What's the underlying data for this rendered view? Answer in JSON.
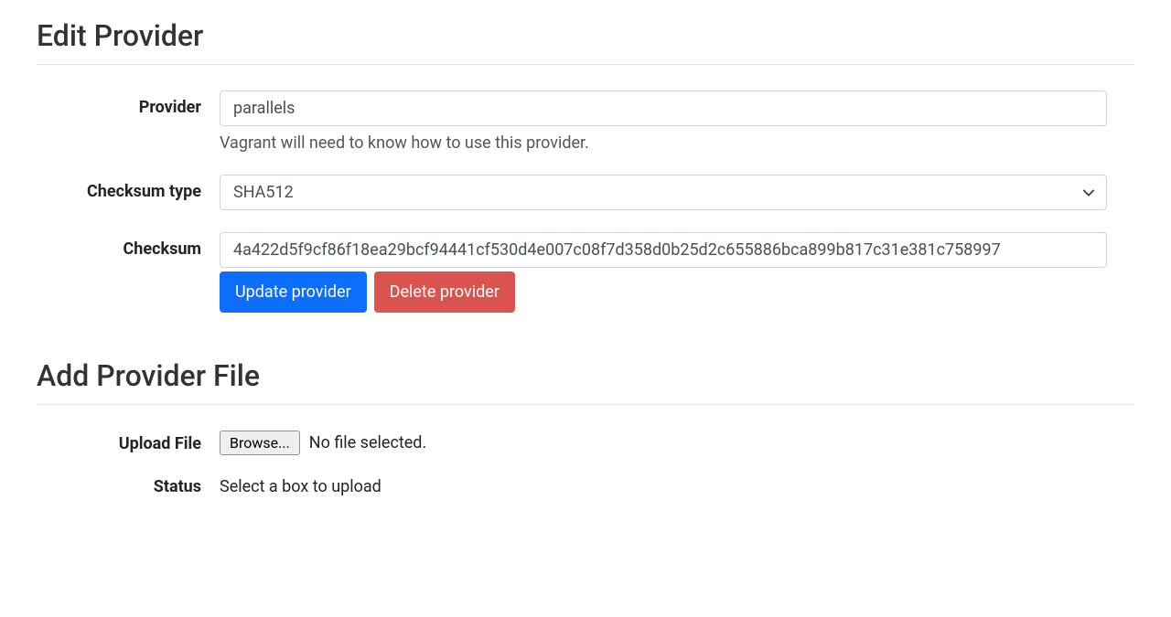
{
  "edit_provider": {
    "heading": "Edit Provider",
    "provider_label": "Provider",
    "provider_value": "parallels",
    "provider_help": "Vagrant will need to know how to use this provider.",
    "checksum_type_label": "Checksum type",
    "checksum_type_value": "SHA512",
    "checksum_label": "Checksum",
    "checksum_value": "4a422d5f9cf86f18ea29bcf94441cf530d4e007c08f7d358d0b25d2c655886bca899b817c31e381c758997",
    "update_btn": "Update provider",
    "delete_btn": "Delete provider"
  },
  "add_file": {
    "heading": "Add Provider File",
    "upload_label": "Upload File",
    "browse_btn": "Browse...",
    "file_selected": "No file selected.",
    "status_label": "Status",
    "status_text": "Select a box to upload"
  }
}
